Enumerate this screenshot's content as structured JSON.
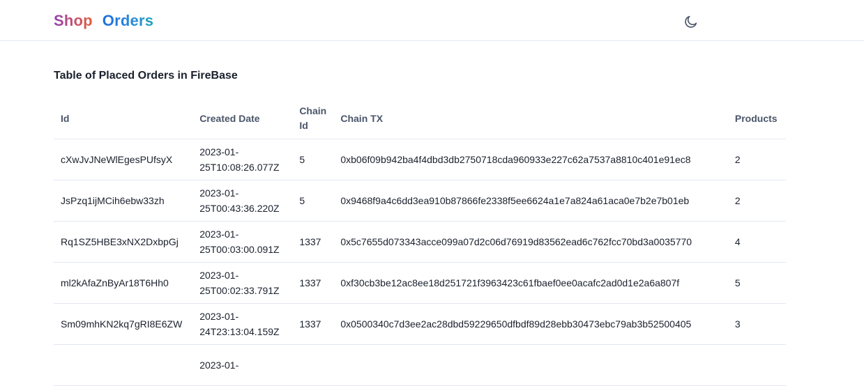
{
  "header": {
    "logo_shop": "Shop",
    "logo_orders": "Orders",
    "theme_icon": "moon-icon"
  },
  "main": {
    "title": "Table of Placed Orders in FireBase",
    "columns": [
      "Id",
      "Created Date",
      "Chain Id",
      "Chain TX",
      "Products"
    ],
    "rows": [
      {
        "id": "cXwJvJNeWlEgesPUfsyX",
        "created": "2023-01-25T10:08:26.077Z",
        "chain_id": "5",
        "tx": "0xb06f09b942ba4f4dbd3db2750718cda960933e227c62a7537a8810c401e91ec8",
        "products": "2"
      },
      {
        "id": "JsPzq1ijMCih6ebw33zh",
        "created": "2023-01-25T00:43:36.220Z",
        "chain_id": "5",
        "tx": "0x9468f9a4c6dd3ea910b87866fe2338f5ee6624a1e7a824a61aca0e7b2e7b01eb",
        "products": "2"
      },
      {
        "id": "Rq1SZ5HBE3xNX2DxbpGj",
        "created": "2023-01-25T00:03:00.091Z",
        "chain_id": "1337",
        "tx": "0x5c7655d073343acce099a07d2c06d76919d83562ead6c762fcc70bd3a0035770",
        "products": "4"
      },
      {
        "id": "ml2kAfaZnByAr18T6Hh0",
        "created": "2023-01-25T00:02:33.791Z",
        "chain_id": "1337",
        "tx": "0xf30cb3be12ac8ee18d251721f3963423c61fbaef0ee0acafc2ad0d1e2a6a807f",
        "products": "5"
      },
      {
        "id": "Sm09mhKN2kq7gRI8E6ZW",
        "created": "2023-01-24T23:13:04.159Z",
        "chain_id": "1337",
        "tx": "0x0500340c7d3ee2ac28dbd59229650dfbdf89d28ebb30473ebc79ab3b52500405",
        "products": "3"
      },
      {
        "id": "",
        "created": "2023-01-",
        "chain_id": "",
        "tx": "",
        "products": ""
      }
    ]
  }
}
